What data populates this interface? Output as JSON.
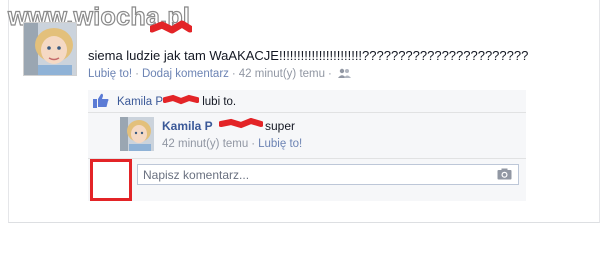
{
  "watermark": "www.wiocha.pl",
  "post": {
    "text": "siema ludzie jak tam WaAKACJE!!!!!!!!!!!!!!!!!!!!!!!???????????????????????",
    "like_link": "Lubię to!",
    "comment_link": "Dodaj komentarz",
    "time": "42 minut(y) temu",
    "audience_icon": "friends-icon"
  },
  "likes": {
    "name": "Kamila P",
    "suffix": "lubi to.",
    "icon": "thumbs-up-icon"
  },
  "comment": {
    "author": "Kamila P",
    "text": "super",
    "time": "42 minut(y) temu",
    "like_link": "Lubię to!"
  },
  "reply": {
    "placeholder": "Napisz komentarz...",
    "icon": "camera-icon"
  },
  "colors": {
    "link": "#6d84b4",
    "name": "#3b5998",
    "redaction": "#e32427",
    "panel_bg": "#f6f7f9"
  }
}
